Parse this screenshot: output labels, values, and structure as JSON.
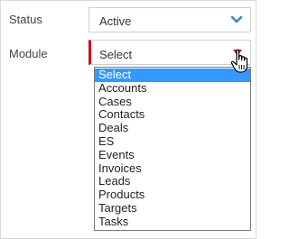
{
  "form": {
    "status_label": "Status",
    "status_value": "Active",
    "module_label": "Module",
    "module_value": "Select"
  },
  "dropdown": {
    "options": [
      "Select",
      "Accounts",
      "Cases",
      "Contacts",
      "Deals",
      "ES",
      "Events",
      "Invoices",
      "Leads",
      "Products",
      "Targets",
      "Tasks"
    ],
    "selected_index": 0
  },
  "icons": {
    "status_chevron": "chevron-down-icon",
    "module_caret": "caret-down-icon",
    "cursor": "hand-pointer-icon"
  },
  "colors": {
    "chevron": "#3a87c8",
    "required_border": "#d0021b",
    "selected_bg": "#3399ff"
  }
}
